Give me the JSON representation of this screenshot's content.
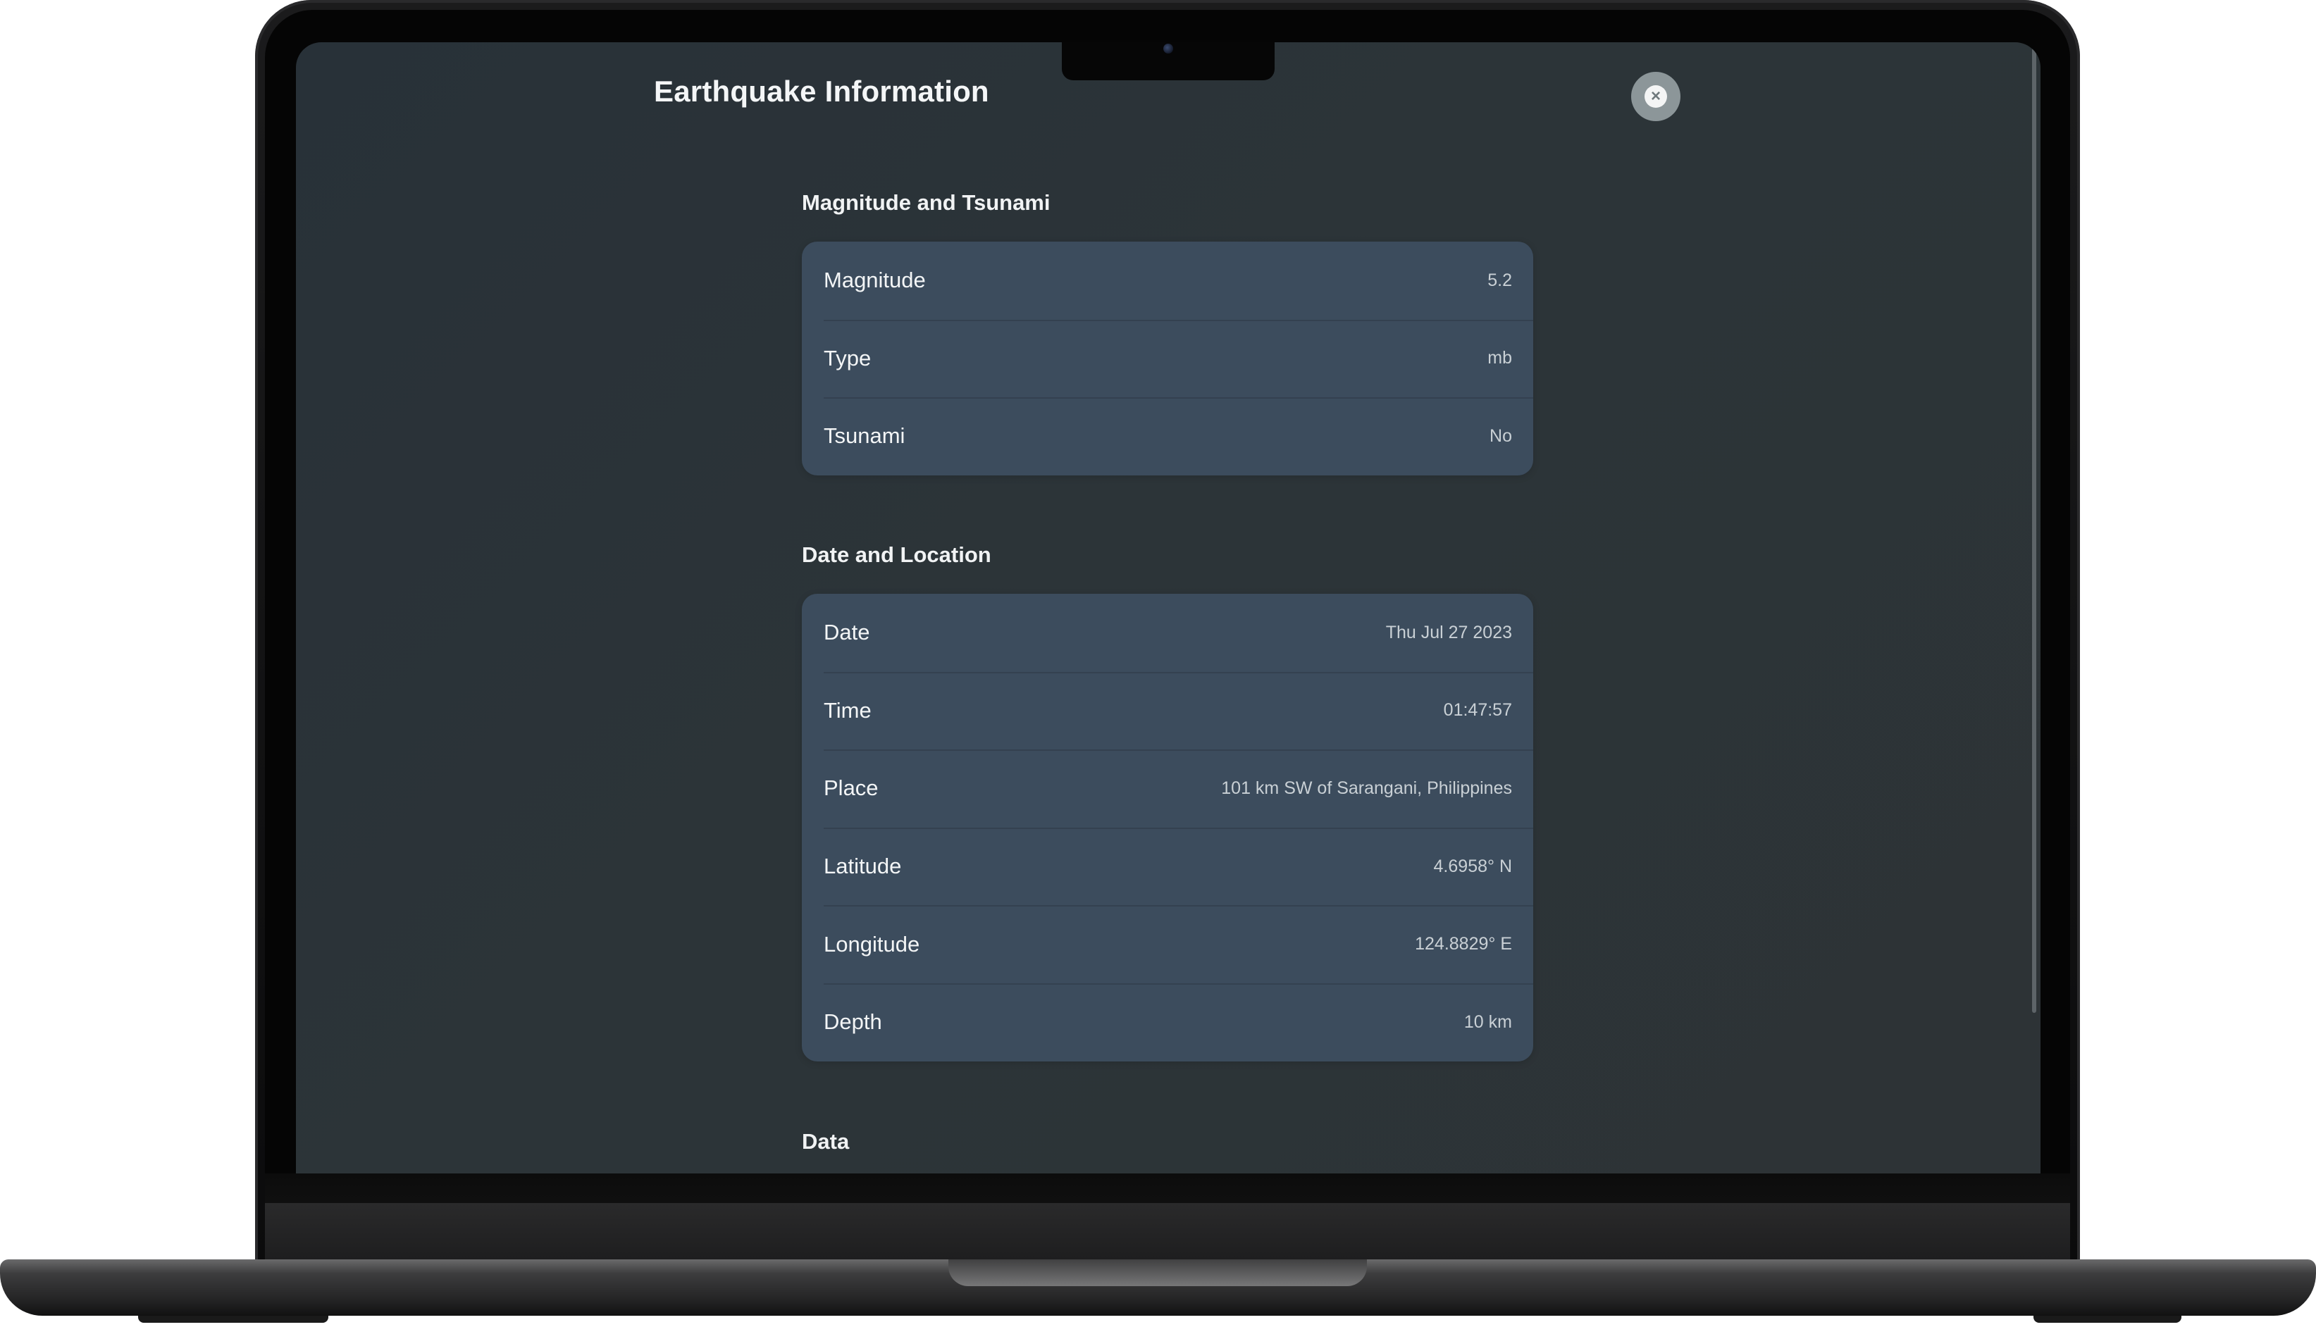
{
  "window": {
    "title": "Earthquake Information",
    "close_icon": "xmark-circle-icon"
  },
  "sections": [
    {
      "header": "Magnitude and Tsunami",
      "rows": [
        {
          "label": "Magnitude",
          "value": "5.2"
        },
        {
          "label": "Type",
          "value": "mb"
        },
        {
          "label": "Tsunami",
          "value": "No"
        }
      ]
    },
    {
      "header": "Date and Location",
      "rows": [
        {
          "label": "Date",
          "value": "Thu Jul 27 2023"
        },
        {
          "label": "Time",
          "value": "01:47:57"
        },
        {
          "label": "Place",
          "value": "101 km SW of Sarangani, Philippines"
        },
        {
          "label": "Latitude",
          "value": "4.6958° N"
        },
        {
          "label": "Longitude",
          "value": "124.8829° E"
        },
        {
          "label": "Depth",
          "value": "10 km"
        }
      ]
    },
    {
      "header": "Data"
    }
  ],
  "colors": {
    "background": "#2b3337",
    "card": "#3c4c5d",
    "title_text": "#f4f6f7",
    "value_text": "#c9d0d5",
    "close_button": "#8c9699"
  }
}
